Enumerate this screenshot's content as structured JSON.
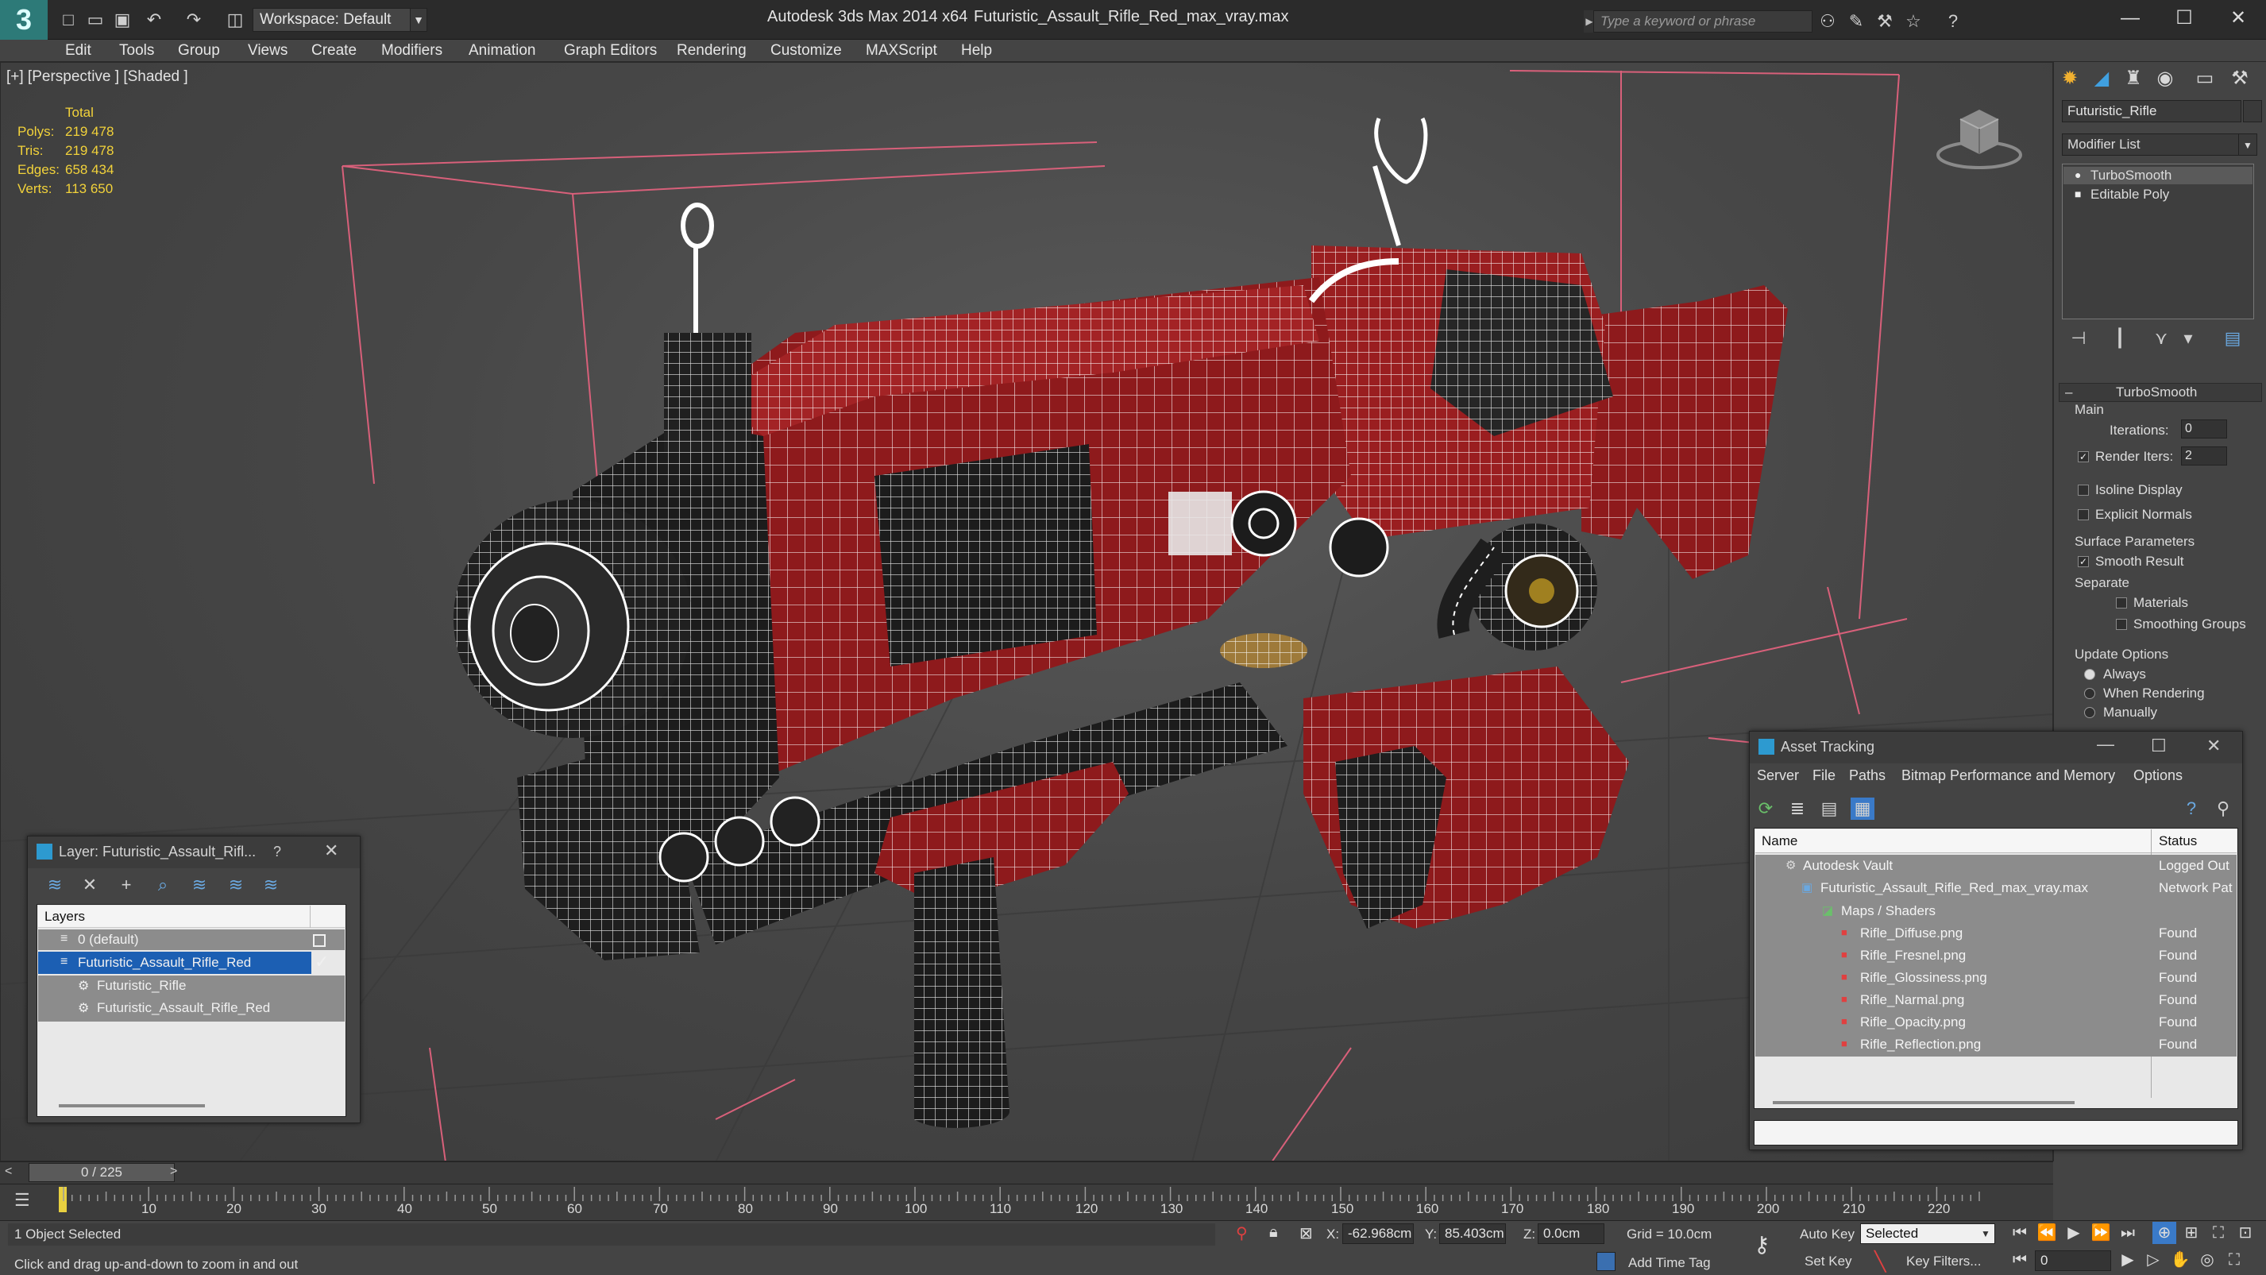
{
  "title_bar": {
    "app_title": "Autodesk 3ds Max  2014 x64",
    "file_title": "Futuristic_Assault_Rifle_Red_max_vray.max",
    "workspace_label": "Workspace: Default",
    "search_placeholder": "Type a keyword or phrase"
  },
  "menus": [
    "Edit",
    "Tools",
    "Group",
    "Views",
    "Create",
    "Modifiers",
    "Animation",
    "Graph Editors",
    "Rendering",
    "Customize",
    "MAXScript",
    "Help"
  ],
  "viewport": {
    "label": "[+] [Perspective ] [Shaded ]",
    "stats": {
      "header": "Total",
      "rows": [
        {
          "label": "Polys:",
          "value": "219 478"
        },
        {
          "label": "Tris:",
          "value": "219 478"
        },
        {
          "label": "Edges:",
          "value": "658 434"
        },
        {
          "label": "Verts:",
          "value": "113 650"
        }
      ]
    }
  },
  "command_panel": {
    "object_name": "Futuristic_Rifle",
    "modifier_list": "Modifier List",
    "stack": [
      "TurboSmooth",
      "Editable Poly"
    ],
    "rollout_title": "TurboSmooth",
    "main_label": "Main",
    "iterations_label": "Iterations:",
    "iterations_value": "0",
    "render_iters_label": "Render Iters:",
    "render_iters_value": "2",
    "isoline_label": "Isoline Display",
    "explicit_normals_label": "Explicit Normals",
    "surface_params_label": "Surface Parameters",
    "smooth_result_label": "Smooth Result",
    "separate_label": "Separate",
    "materials_label": "Materials",
    "smoothing_groups_label": "Smoothing Groups",
    "update_options_label": "Update Options",
    "always_label": "Always",
    "when_rendering_label": "When Rendering",
    "manually_label": "Manually"
  },
  "layer_window": {
    "title": "Layer: Futuristic_Assault_Rifl...",
    "help": "?",
    "header": "Layers",
    "rows": [
      {
        "label": "0 (default)"
      },
      {
        "label": "Futuristic_Assault_Rifle_Red"
      },
      {
        "label": "Futuristic_Rifle"
      },
      {
        "label": "Futuristic_Assault_Rifle_Red"
      }
    ]
  },
  "asset_window": {
    "title": "Asset Tracking",
    "menus": [
      "Server",
      "File",
      "Paths",
      "Bitmap Performance and Memory",
      "Options"
    ],
    "col_name": "Name",
    "col_status": "Status",
    "rows": [
      {
        "name": "Autodesk Vault",
        "status": "Logged Out"
      },
      {
        "name": "Futuristic_Assault_Rifle_Red_max_vray.max",
        "status": "Network Pat"
      },
      {
        "name": "Maps / Shaders",
        "status": ""
      },
      {
        "name": "Rifle_Diffuse.png",
        "status": "Found"
      },
      {
        "name": "Rifle_Fresnel.png",
        "status": "Found"
      },
      {
        "name": "Rifle_Glossiness.png",
        "status": "Found"
      },
      {
        "name": "Rifle_Narmal.png",
        "status": "Found"
      },
      {
        "name": "Rifle_Opacity.png",
        "status": "Found"
      },
      {
        "name": "Rifle_Reflection.png",
        "status": "Found"
      }
    ]
  },
  "timeline": {
    "slider_label": "0 / 225",
    "ticks": [
      "10",
      "20",
      "30",
      "40",
      "50",
      "60",
      "70",
      "80",
      "90",
      "100",
      "110",
      "120",
      "130",
      "140",
      "150",
      "160",
      "170",
      "180",
      "190",
      "200",
      "210",
      "220"
    ]
  },
  "status_bar": {
    "selection": "1 Object Selected",
    "prompt": "Click and drag up-and-down to zoom in and out",
    "x_label": "X:",
    "x_value": "-62.968cm",
    "y_label": "Y:",
    "y_value": "85.403cm",
    "z_label": "Z:",
    "z_value": "0.0cm",
    "grid": "Grid = 10.0cm",
    "add_time_tag": "Add Time Tag",
    "auto_key": "Auto Key",
    "set_key": "Set Key",
    "selected": "Selected",
    "key_filters": "Key Filters...",
    "frame": "0"
  },
  "colors": {
    "accent": "#2d7a78",
    "stats": "#f2d23a",
    "selection": "#1c5fb3",
    "model_red": "#8e1a1c",
    "grid_lines": "#d8607a"
  }
}
